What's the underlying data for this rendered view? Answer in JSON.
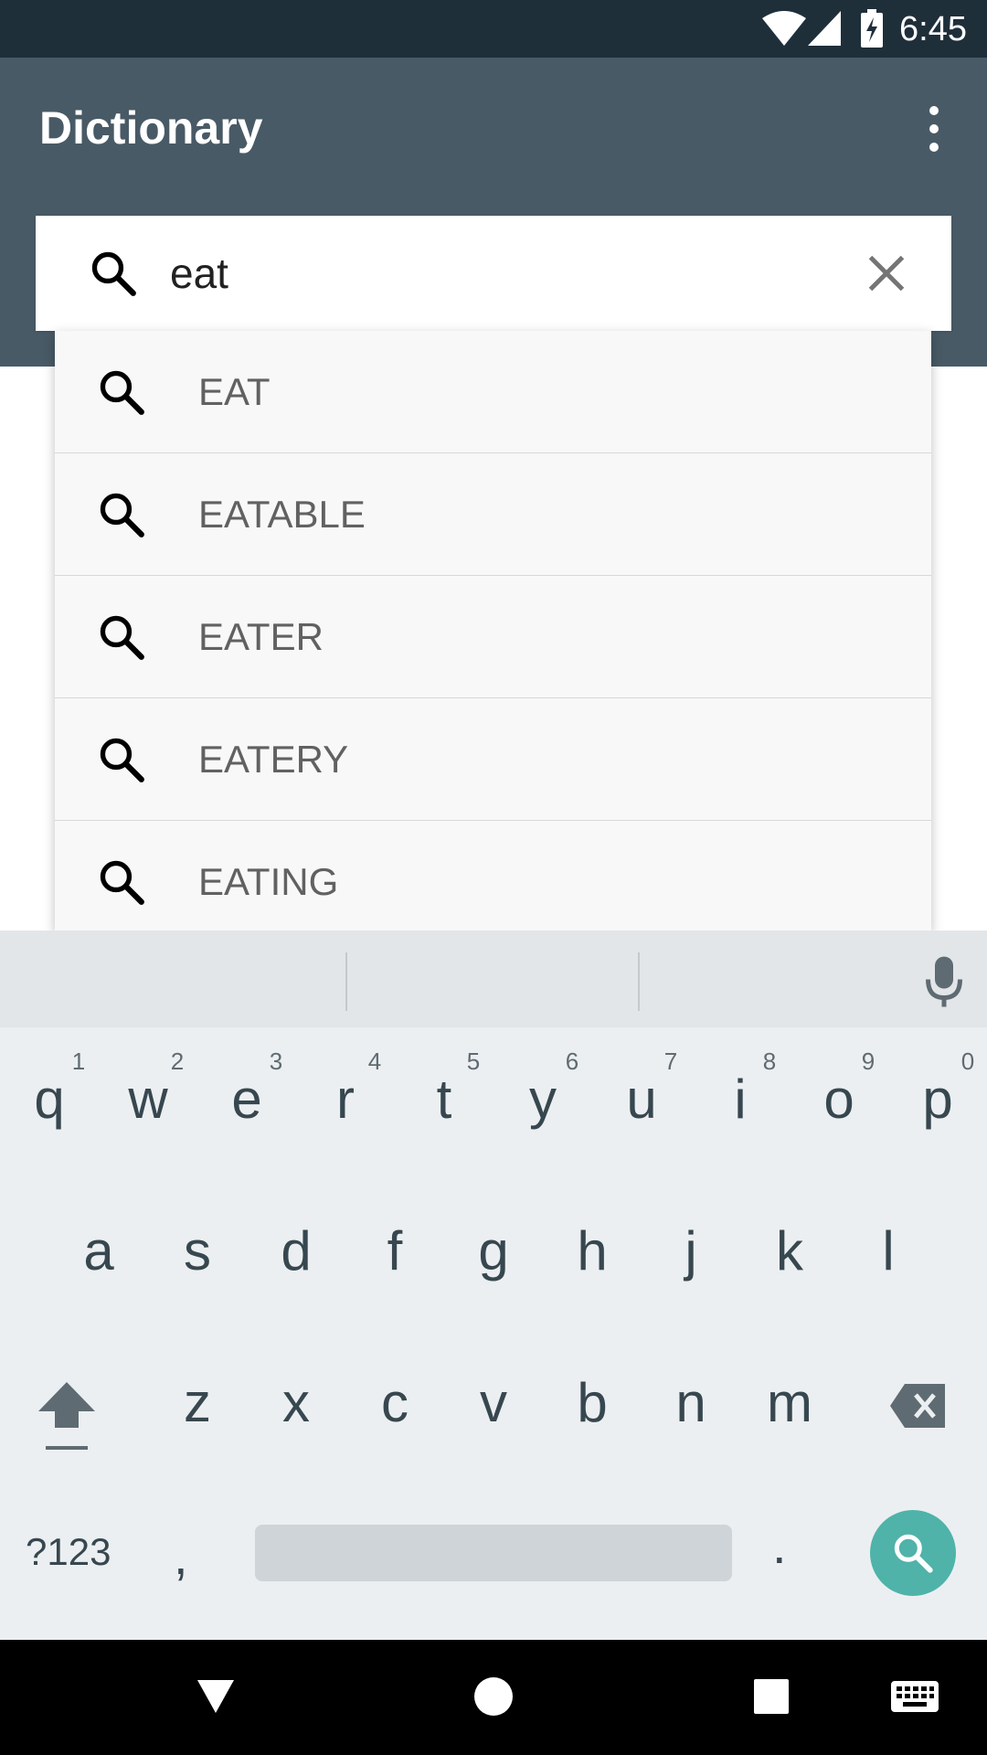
{
  "status_bar": {
    "time": "6:45",
    "icons": [
      "wifi-icon",
      "signal-icon",
      "battery-charging-icon"
    ]
  },
  "app_bar": {
    "title": "Dictionary",
    "overflow_icon": "more-vert-icon"
  },
  "search": {
    "query": "eat",
    "icon": "search-icon",
    "clear_icon": "close-icon"
  },
  "suggestions": [
    {
      "label": "EAT"
    },
    {
      "label": "EATABLE"
    },
    {
      "label": "EATER"
    },
    {
      "label": "EATERY"
    },
    {
      "label": "EATING"
    }
  ],
  "keyboard": {
    "row1": [
      "q",
      "w",
      "e",
      "r",
      "t",
      "y",
      "u",
      "i",
      "o",
      "p"
    ],
    "row1_hints": [
      "1",
      "2",
      "3",
      "4",
      "5",
      "6",
      "7",
      "8",
      "9",
      "0"
    ],
    "row2": [
      "a",
      "s",
      "d",
      "f",
      "g",
      "h",
      "j",
      "k",
      "l"
    ],
    "row3": [
      "z",
      "x",
      "c",
      "v",
      "b",
      "n",
      "m"
    ],
    "symbols_label": "?123",
    "comma": ",",
    "period": ".",
    "action_icon": "search-icon",
    "accent_color": "#4fb3a9"
  },
  "nav_bar": {
    "buttons": [
      "back-icon",
      "home-icon",
      "recents-icon",
      "keyboard-icon"
    ]
  },
  "colors": {
    "status_bar": "#1f2f3a",
    "app_bar": "#485a66",
    "keyboard_bg": "#eceff1"
  }
}
